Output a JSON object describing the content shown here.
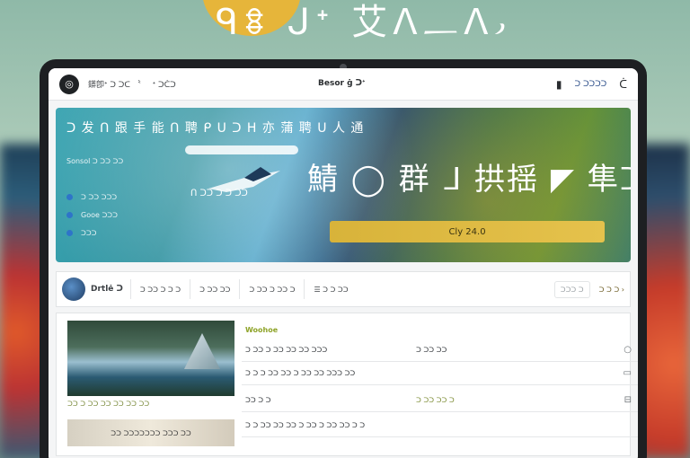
{
  "hero": {
    "title": "ᑫꗊ ᒍᐩ 艾ᐱ᎗ᐱ᎖"
  },
  "nav": {
    "logo": "◎",
    "links": [
      "䥈卽ᐩ ᑐ  ᑐᑕ 〝",
      "ᐩ ᑐᑖᑐ"
    ],
    "brand": "Besor ġ ᑐᐩ",
    "user_icon": "▮",
    "user_link": "ᑐ ᑐᑐᑐᑐ",
    "menu_icon": "ᑖ"
  },
  "banner": {
    "headline": "ᑐ 发 ᑎ 跟 手 能 ᑎ 聘 ᑭ ᑌ ᑐ ᕼ 亦 蒲 聘 ᑌ 人 通",
    "sub": "Sonsol ᑐ ᑐᑐ ᑐᑐ",
    "bullets": [
      "ᑐ ᑐᑐ ᑐᑐᑐ",
      "Gooe ᑐᑐᑐ",
      "ᑐᑐᑐ"
    ],
    "figure_caption": "ᑎ ᑐᑐ ᑐ ᑐ ᑐᑐ",
    "big_title": "鯖 ◯ 群 ᒧ 拱揺 ◤ 隼ᑐ",
    "cta_label": "Cly 24.0"
  },
  "filterbar": {
    "user": "Drtlė ᑐ",
    "items": [
      "ᑐ ᑐᑐ ᑐ ᑐ ᑐ",
      "ᑐ ᑐᑐ ᑐᑐ",
      "ᑐ ᑐᑐ ᑐ ᑐᑐ ᑐ",
      "☰ ᑐ ᑐ ᑐᑐ"
    ],
    "pill": "ᑐᑐᑐ ᑐ",
    "right": "ᑐ ᑐ ᑐ ›"
  },
  "content": {
    "thumb_caption": "ᑐᑐ ᑐ ᑐᑐ ᑐᑐ ᑐᑐ ᑐᑐ ᑐᑐ",
    "small_thumb": "ᑐᑐ ᑐᑐᑐᑐᑐᑐᑐ ᑐᑐᑐ ᑐᑐ",
    "tag": "Woohoe",
    "rows": [
      {
        "left": "ᑐ ᑐᑐ ᑐ ᑐᑐ ᑐᑐ ᑐᑐ ᑐᑐᑐ",
        "right": "ᑐ ᑐᑐ ᑐᑐ",
        "icon": "○"
      },
      {
        "left": "ᑐ ᑐ ᑐ ᑐᑐ ᑐᑐ ᑐ ᑐᑐ ᑐᑐ ᑐᑐᑐ ᑐᑐ",
        "right": "",
        "icon": "▭"
      },
      {
        "left": "ᑐᑐ ᑐ ᑐ",
        "right": "ᑐ ᑐᑐ ᑐᑐ ᑐ",
        "icon": "⊟"
      },
      {
        "left": "ᑐ ᑐ ᑐᑐ ᑐᑐ ᑐᑐ ᑐ ᑐᑐ ᑐ ᑐᑐ ᑐᑐ ᑐ ᑐ",
        "right": "",
        "icon": ""
      }
    ]
  }
}
